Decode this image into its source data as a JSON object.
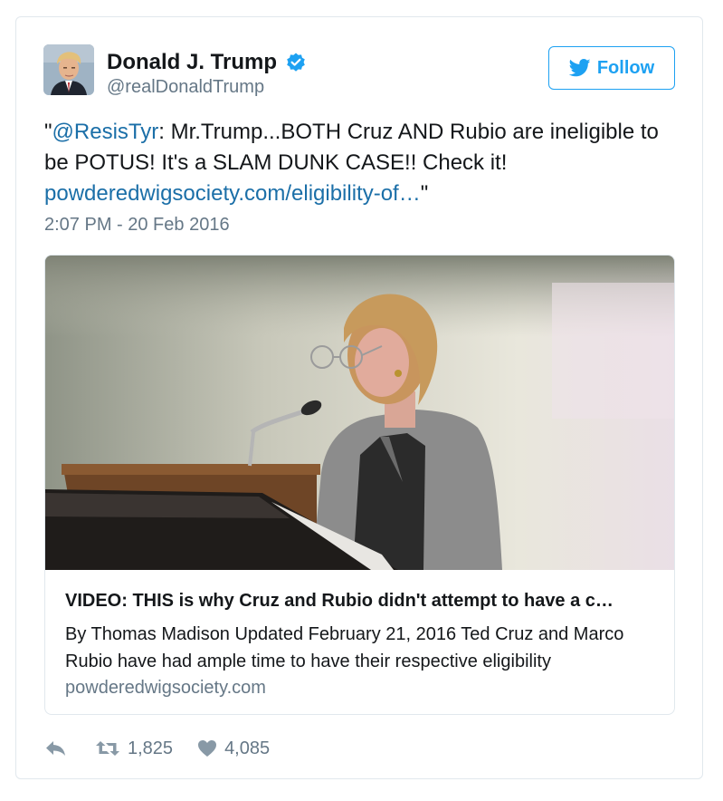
{
  "author": {
    "name": "Donald J. Trump",
    "handle": "@realDonaldTrump",
    "verified_icon": "verified-badge-icon",
    "avatar_icon": "profile-photo"
  },
  "follow": {
    "label": "Follow",
    "icon": "twitter-bird-icon",
    "color": "#1da1f2"
  },
  "tweet": {
    "quote_open": "\"",
    "mention": "@ResisTyr",
    "body": ": Mr.Trump...BOTH Cruz AND Rubio are ineligible to be POTUS! It's a SLAM DUNK CASE!! Check it! ",
    "link": "powderedwigsociety.com/eligibility-of…",
    "quote_close": "\"",
    "timestamp": "2:07 PM - 20 Feb 2016",
    "link_color": "#1b6fa8"
  },
  "card": {
    "image_icon": "video-thumbnail-woman-at-podium",
    "title": "VIDEO: THIS is why Cruz and Rubio didn't attempt to have a c…",
    "description": "By Thomas Madison Updated February 21, 2016 Ted Cruz and Marco Rubio have had ample time to have their respective eligibility",
    "domain": "powderedwigsociety.com"
  },
  "actions": {
    "reply_icon": "reply-icon",
    "retweet_icon": "retweet-icon",
    "retweet_count": "1,825",
    "like_icon": "heart-icon",
    "like_count": "4,085"
  }
}
